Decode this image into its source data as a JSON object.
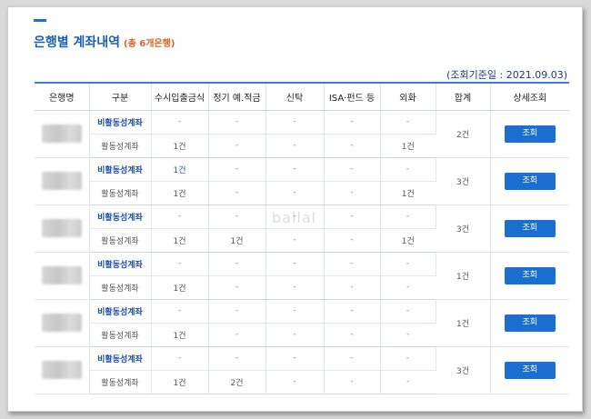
{
  "page": {
    "title": "은행별 계좌내역",
    "count_label": "(총 6개은행)",
    "base_date": "(조회기준일 : 2021.09.03)",
    "watermark": "ballal"
  },
  "table": {
    "headers": [
      "은행명",
      "구분",
      "수시입출금식",
      "정기 예.적금",
      "신탁",
      "ISA·펀드 등",
      "외화",
      "합계",
      "상세조회"
    ],
    "type_inactive": "비활동성계좌",
    "type_active": "활동성계좌",
    "view_label": "조회",
    "groups": [
      {
        "inactive": [
          "-",
          "-",
          "-",
          "-",
          "-"
        ],
        "active": [
          "1건",
          "-",
          "-",
          "-",
          "1건"
        ],
        "total": "2건"
      },
      {
        "inactive": [
          "1건",
          "-",
          "-",
          "-",
          "-"
        ],
        "active": [
          "1건",
          "-",
          "-",
          "-",
          "1건"
        ],
        "total": "3건"
      },
      {
        "inactive": [
          "-",
          "-",
          "-",
          "-",
          "-"
        ],
        "active": [
          "1건",
          "1건",
          "-",
          "-",
          "1건"
        ],
        "total": "3건"
      },
      {
        "inactive": [
          "-",
          "-",
          "-",
          "-",
          "-"
        ],
        "active": [
          "1건",
          "-",
          "-",
          "-",
          "-"
        ],
        "total": "1건"
      },
      {
        "inactive": [
          "-",
          "-",
          "-",
          "-",
          "-"
        ],
        "active": [
          "1건",
          "-",
          "-",
          "-",
          "-"
        ],
        "total": "1건"
      },
      {
        "inactive": [
          "-",
          "-",
          "-",
          "-",
          "-"
        ],
        "active": [
          "1건",
          "2건",
          "-",
          "-",
          "-"
        ],
        "total": "3건"
      }
    ]
  }
}
